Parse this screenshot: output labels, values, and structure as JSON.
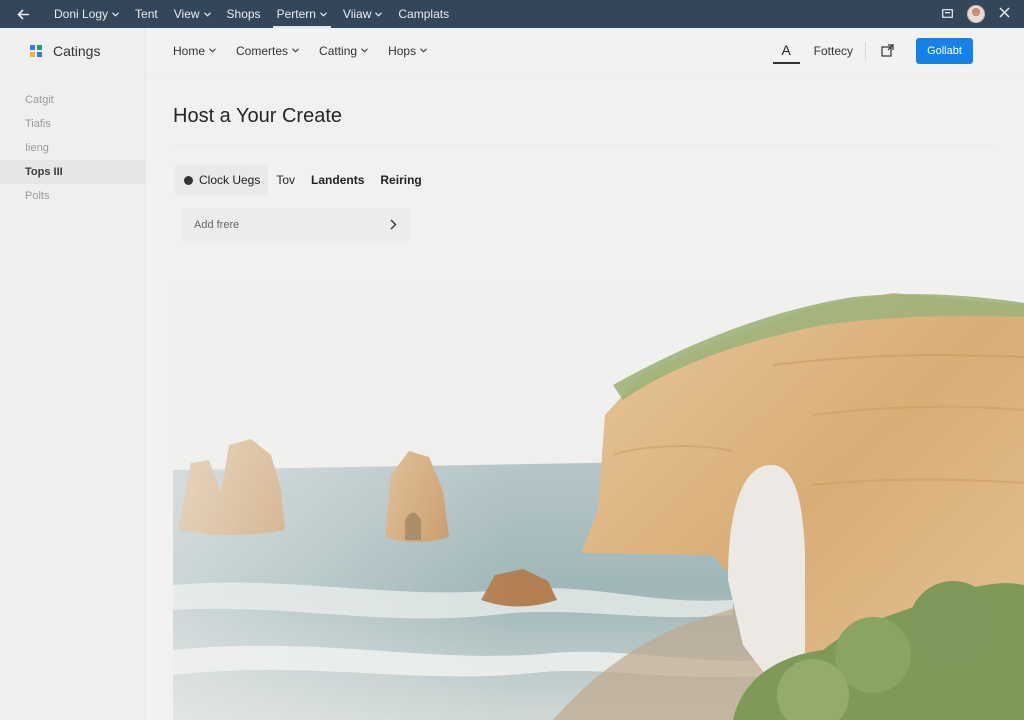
{
  "topbar": {
    "menu": [
      {
        "label": "Doni Logy",
        "caret": true,
        "active": false
      },
      {
        "label": "Tent",
        "caret": false,
        "active": false
      },
      {
        "label": "View",
        "caret": true,
        "active": false
      },
      {
        "label": "Shops",
        "caret": false,
        "active": false
      },
      {
        "label": "Pertern",
        "caret": true,
        "active": true
      },
      {
        "label": "Viiaw",
        "caret": true,
        "active": false
      },
      {
        "label": "Camplats",
        "caret": false,
        "active": false
      }
    ]
  },
  "sidebar": {
    "brand": "Catings",
    "items": [
      {
        "label": "Catgit",
        "active": false
      },
      {
        "label": "Tiafis",
        "active": false
      },
      {
        "label": "Iieng",
        "active": false
      },
      {
        "label": "Tops III",
        "active": true
      },
      {
        "label": "Polts",
        "active": false
      }
    ]
  },
  "header": {
    "nav": [
      {
        "label": "Home"
      },
      {
        "label": "Comertes"
      },
      {
        "label": "Catting"
      },
      {
        "label": "Hops"
      }
    ],
    "font_label": "A",
    "link": "Fottecy",
    "primary_button": "Gollabt"
  },
  "main": {
    "title": "Host a Your Create",
    "tabs": [
      "Clock Uegs",
      "Tov",
      "Landents",
      "Reiring"
    ],
    "add_row": "Add frere"
  },
  "colors": {
    "topbar": "#34465a",
    "accent": "#1383ea",
    "background": "#f1f1f0"
  }
}
